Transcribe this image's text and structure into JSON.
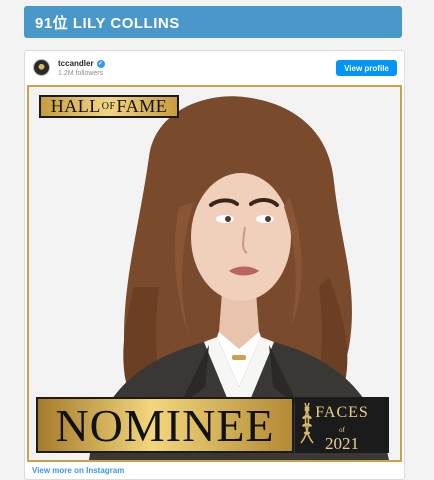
{
  "heading": {
    "title": "91位 LILY COLLINS"
  },
  "embed": {
    "username": "tccandler",
    "followers": "1.2M followers",
    "view_profile": "View profile",
    "view_more": "View more on Instagram"
  },
  "badge": {
    "hall_part1": "HALL",
    "hall_of": "OF",
    "hall_part2": "FAME",
    "nominee": "NOMINEE",
    "faces": "FACES",
    "faces_of": "of",
    "faces_year": "2021"
  },
  "colors": {
    "heading_bg": "#4a98c9",
    "button_bg": "#0095f6",
    "gold": "#c9a24a"
  }
}
